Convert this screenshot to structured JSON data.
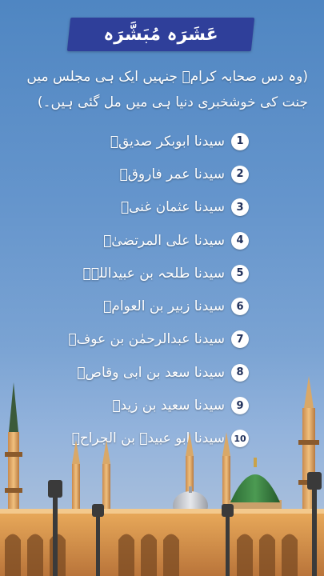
{
  "header": {
    "title": "عَشَرَہ مُبَشَّرَہ"
  },
  "intro": {
    "text": "(وہ دس صحابہ کرامؓ جنہیں ایک ہی مجلس میں جنت کی خوشخبری دنیا ہی میں مل گئی ہیں۔)"
  },
  "list": [
    {
      "num": "1",
      "name": "سیدنا ابوبکر صدیقؓ"
    },
    {
      "num": "2",
      "name": "سیدنا عمر فاروقؓ"
    },
    {
      "num": "3",
      "name": "سیدنا عثمان غنیؓ"
    },
    {
      "num": "4",
      "name": "سیدنا علی المرتضیٰؓ"
    },
    {
      "num": "5",
      "name": "سیدنا طلحہ بن عبیداللہؓ"
    },
    {
      "num": "6",
      "name": "سیدنا زبیر بن العوامؓ"
    },
    {
      "num": "7",
      "name": "سیدنا عبدالرحمٰن بن عوفؓ"
    },
    {
      "num": "8",
      "name": "سیدنا سعد بن ابی وقاصؓ"
    },
    {
      "num": "9",
      "name": "سیدنا سعید بن زیدؓ"
    },
    {
      "num": "10",
      "name": "سیدنا ابو عبیدہ بن الجراحؓ"
    }
  ],
  "colors": {
    "banner": "#2f3f9a",
    "sky_top": "#4f86c2",
    "dome_green": "#2f7a3a",
    "dome_silver": "#c9ccd2",
    "building": "#d99a4e"
  }
}
